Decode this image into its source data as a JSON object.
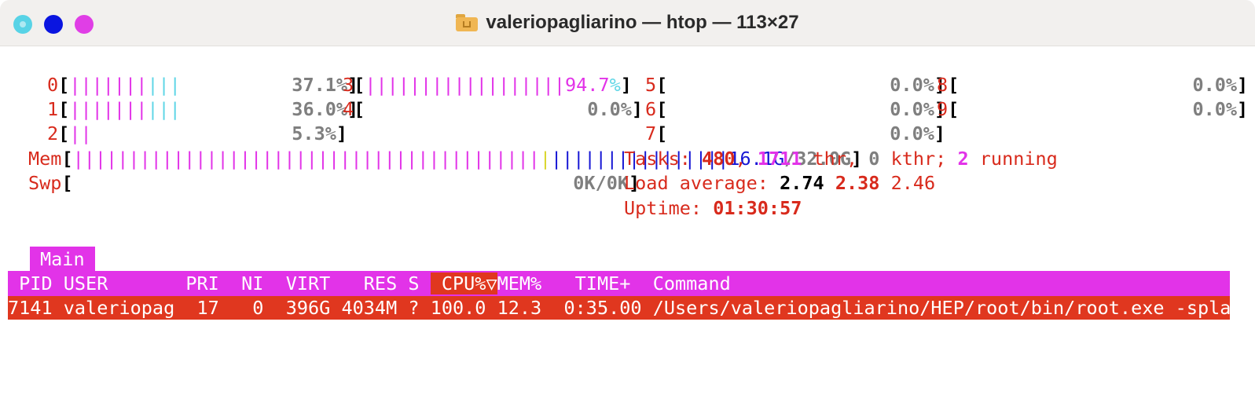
{
  "window": {
    "title": "valeriopagliarino — htop — 113×27",
    "title_icon": "folder-home-icon"
  },
  "cpus": [
    {
      "id": "0",
      "bar_green_magenta": "|||||||",
      "bar_cyan": "|||",
      "value": "37.1%"
    },
    {
      "id": "1",
      "bar_green_magenta": "|||||||",
      "bar_cyan": "|||",
      "value": "36.0%"
    },
    {
      "id": "2",
      "bar_green_magenta": "||",
      "bar_cyan": "",
      "value": "5.3%"
    },
    {
      "id": "3",
      "bar_green_magenta": "||||||||||||||||||",
      "bar_cyan": "",
      "value_num": "94.7",
      "value_pct": "%"
    },
    {
      "id": "4",
      "value": "0.0%"
    },
    {
      "id": "5",
      "value": "0.0%"
    },
    {
      "id": "6",
      "value": "0.0%"
    },
    {
      "id": "7",
      "value": "0.0%"
    },
    {
      "id": "8",
      "value": "0.0%"
    },
    {
      "id": "9",
      "value": "0.0%"
    }
  ],
  "mem": {
    "label": "Mem",
    "bar_mag": "||||||||||||||||||||||||||||||||||||||||||",
    "bar_yel": "|",
    "bar_blue": "||||||||||||||||",
    "used": "16.1G",
    "total": "/32.0G"
  },
  "swp": {
    "label": "Swp",
    "value": "0K/0K"
  },
  "tasks": {
    "label": "Tasks: ",
    "count": "480",
    "sep1": ", ",
    "thr": "1711",
    "thr_label": " thr, ",
    "kthr": "0",
    "kthr_label": " kthr; ",
    "running": "2",
    "running_label": " running"
  },
  "load": {
    "label": "Load average: ",
    "l1": "2.74",
    "l5": "2.38",
    "l15": "2.46"
  },
  "uptime": {
    "label": "Uptime: ",
    "value": "01:30:57"
  },
  "tabs": [
    {
      "label": "Main"
    }
  ],
  "columns": {
    "pid": " PID",
    "user": "USER",
    "pri": "PRI",
    "ni": "NI",
    "virt": "VIRT",
    "res": "RES",
    "s": "S",
    "cpu": "CPU%▽",
    "mem": "MEM%",
    "time": "TIME+",
    "command": "Command"
  },
  "processes": [
    {
      "pid": "7141",
      "user": "valeriopag",
      "pri": "17",
      "ni": "0",
      "virt": "396G",
      "res": "4034M",
      "s": "?",
      "cpu": "100.0",
      "mem": "12.3",
      "time": "0:35.00",
      "command": "/Users/valeriopagliarino/HEP/root/bin/root.exe -splash"
    }
  ]
}
